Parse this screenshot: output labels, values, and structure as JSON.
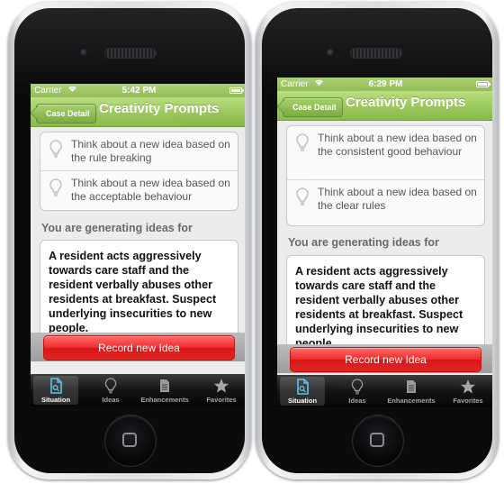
{
  "colors": {
    "nav_green": "#98c65a",
    "record_red": "#e02525",
    "tabbar_black": "#141414",
    "screen_bg": "#ececec"
  },
  "phones": [
    {
      "statusbar": {
        "carrier": "Carrier",
        "time": "5:42 PM",
        "wifi_icon": "wifi-icon",
        "battery_icon": "battery-icon"
      },
      "navbar": {
        "back_label": "Case Detail",
        "title": "Creativity Prompts"
      },
      "prompts": [
        {
          "icon": "lightbulb-icon",
          "text": "Think about a new idea based on the rule breaking"
        },
        {
          "icon": "lightbulb-icon",
          "text": "Think about a new idea based on the acceptable behaviour"
        }
      ],
      "section_label": "You are generating ideas for",
      "situation_text": "A resident acts aggressively towards care staff and the resident verbally abuses other residents at breakfast. Suspect underlying insecurities to new people.",
      "record_button_label": "Record new Idea",
      "tabs": [
        {
          "label": "Situation",
          "icon": "document-icon",
          "selected": true
        },
        {
          "label": "Ideas",
          "icon": "lightbulb-icon",
          "selected": false
        },
        {
          "label": "Enhancements",
          "icon": "page-icon",
          "selected": false
        },
        {
          "label": "Favorites",
          "icon": "star-icon",
          "selected": false
        }
      ]
    },
    {
      "statusbar": {
        "carrier": "Carrier",
        "time": "6:29 PM",
        "wifi_icon": "wifi-icon",
        "battery_icon": "battery-icon"
      },
      "navbar": {
        "back_label": "Case Detail",
        "title": "Creativity Prompts"
      },
      "prompts": [
        {
          "icon": "lightbulb-icon",
          "text": "Think about a new idea based on the consistent good behaviour"
        },
        {
          "icon": "lightbulb-icon",
          "text": "Think about a new idea based on the clear rules"
        }
      ],
      "section_label": "You are generating ideas for",
      "situation_text": "A resident acts aggressively towards care staff and the resident verbally abuses other residents at breakfast. Suspect underlying insecurities to new people.",
      "record_button_label": "Record new Idea",
      "tabs": [
        {
          "label": "Situation",
          "icon": "document-icon",
          "selected": true
        },
        {
          "label": "Ideas",
          "icon": "lightbulb-icon",
          "selected": false
        },
        {
          "label": "Enhancements",
          "icon": "page-icon",
          "selected": false
        },
        {
          "label": "Favorites",
          "icon": "star-icon",
          "selected": false
        }
      ]
    }
  ]
}
